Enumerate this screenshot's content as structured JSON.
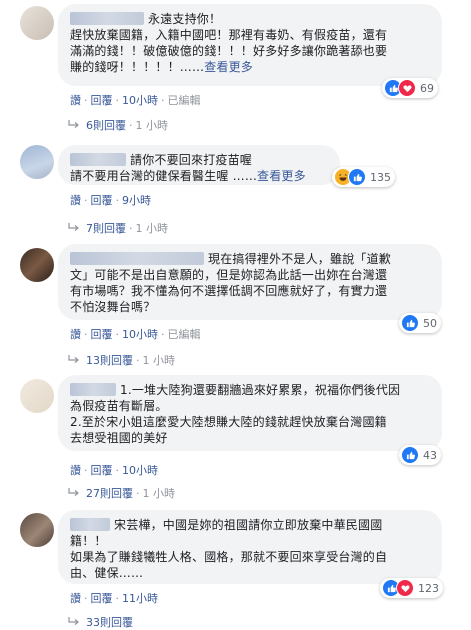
{
  "actions": {
    "like": "讚",
    "reply": "回覆",
    "edited": "已編輯",
    "dot": "·"
  },
  "comments": [
    {
      "lines": [
        "永遠支持你！",
        "趕快放棄國籍，入籍中國吧！那裡有毒奶、有假疫苗，還有",
        "滿滿的錢！！破億破億的錢！！！好多好多讓你跪著舔也要",
        "賺的錢呀！！！！！……"
      ],
      "see_more": "查看更多",
      "reactions": [
        "like",
        "love"
      ],
      "count": "69",
      "time": "10小時",
      "edited": true,
      "replies_label": "6則回覆",
      "replies_time": "1 小時"
    },
    {
      "lines": [
        "請你不要回來打疫苗喔",
        "請不要用台灣的健保看醫生喔 ……"
      ],
      "see_more": "查看更多",
      "reactions": [
        "haha",
        "like"
      ],
      "count": "135",
      "time": "9小時",
      "edited": false,
      "replies_label": "7則回覆",
      "replies_time": "1 小時"
    },
    {
      "lines": [
        "現在搞得裡外不是人，雖說「道歉",
        "文」可能不是出自意願的，但是妳認為此話一出妳在台灣還",
        "有市場嗎？我不懂為何不選擇低調不回應就好了，有實力還",
        "不怕沒舞台嗎？"
      ],
      "see_more": "",
      "reactions": [
        "like"
      ],
      "count": "50",
      "time": "10小時",
      "edited": true,
      "replies_label": "13則回覆",
      "replies_time": "1 小時"
    },
    {
      "lines": [
        "1.一堆大陸狗還要翻牆過來好累累，祝福你們後代因",
        "為假疫苗有斷層。",
        "2.至於宋小姐這麼愛大陸想賺大陸的錢就趕快放棄台灣國籍",
        "去想受祖國的美好"
      ],
      "see_more": "",
      "reactions": [
        "like"
      ],
      "count": "43",
      "time": "10小時",
      "edited": false,
      "replies_label": "27則回覆",
      "replies_time": "1 小時"
    },
    {
      "lines": [
        "宋芸樺，中國是妳的祖國請你立即放棄中華民國國",
        "籍！！",
        "如果為了賺錢犧牲人格、國格，那就不要回來享受台灣的自",
        "由、健保……"
      ],
      "see_more": "",
      "reactions": [
        "like",
        "love"
      ],
      "count": "123",
      "time": "11小時",
      "edited": false,
      "replies_label": "33則回覆",
      "replies_time": ""
    }
  ],
  "colors": {
    "bubble": "#f2f3f5",
    "link": "#385898",
    "muted": "#90949c",
    "like": "#2078f4",
    "love": "#f0284a",
    "haha": "#f7b125"
  },
  "icons": {
    "like": "thumbs-up-icon",
    "love": "heart-icon",
    "haha": "laughing-face-icon",
    "reply": "reply-arrow-icon"
  }
}
